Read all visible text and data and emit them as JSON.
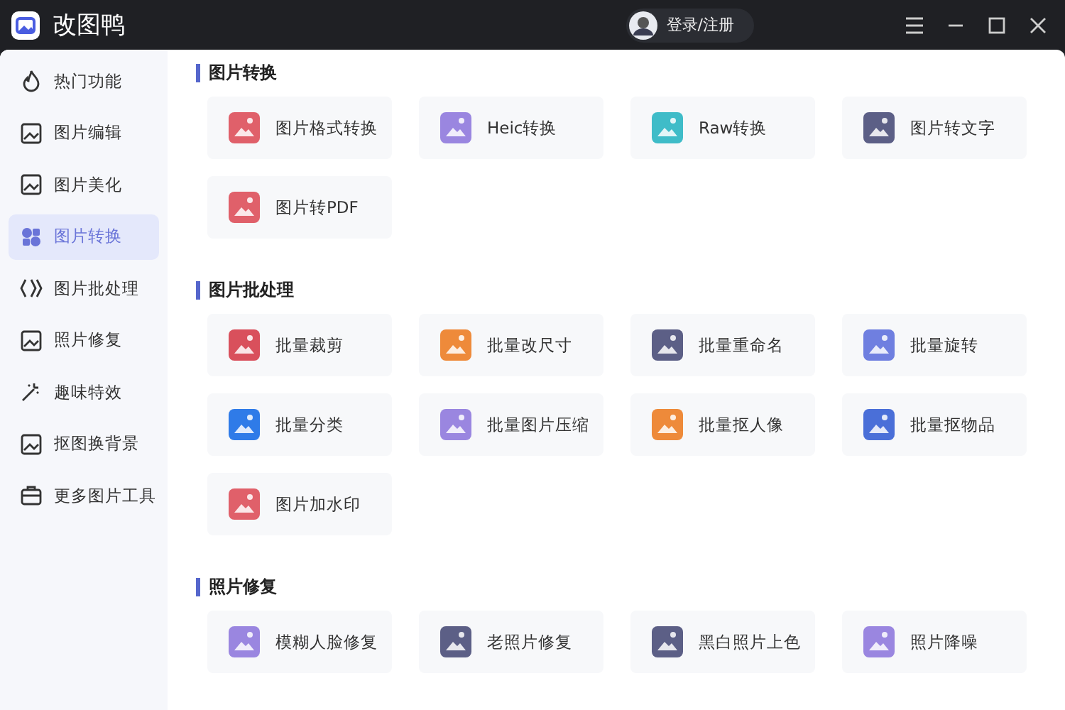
{
  "window": {
    "title": "改图鸭",
    "login": "登录/注册"
  },
  "sidebar": {
    "items": [
      {
        "label": "热门功能",
        "selected": false
      },
      {
        "label": "图片编辑",
        "selected": false
      },
      {
        "label": "图片美化",
        "selected": false
      },
      {
        "label": "图片转换",
        "selected": true
      },
      {
        "label": "图片批处理",
        "selected": false
      },
      {
        "label": "照片修复",
        "selected": false
      },
      {
        "label": "趣味特效",
        "selected": false
      },
      {
        "label": "抠图换背景",
        "selected": false
      },
      {
        "label": "更多图片工具",
        "selected": false
      }
    ]
  },
  "sections": [
    {
      "title": "图片转换",
      "tools": [
        {
          "label": "图片格式转换",
          "color": "#e0606a"
        },
        {
          "label": "Heic转换",
          "color": "#9a86e0"
        },
        {
          "label": "Raw转换",
          "color": "#3fbcc8"
        },
        {
          "label": "图片转文字",
          "color": "#5c5f86"
        },
        {
          "label": "图片转PDF",
          "color": "#e0606a"
        }
      ]
    },
    {
      "title": "图片批处理",
      "tools": [
        {
          "label": "批量裁剪",
          "color": "#d9505c"
        },
        {
          "label": "批量改尺寸",
          "color": "#ee8a3a"
        },
        {
          "label": "批量重命名",
          "color": "#5c5f86"
        },
        {
          "label": "批量旋转",
          "color": "#6f7fe0"
        },
        {
          "label": "批量分类",
          "color": "#2f7be8"
        },
        {
          "label": "批量图片压缩",
          "color": "#9a86e0"
        },
        {
          "label": "批量抠人像",
          "color": "#ee8a3a"
        },
        {
          "label": "批量抠物品",
          "color": "#4a6fd8"
        },
        {
          "label": "图片加水印",
          "color": "#e0606a"
        }
      ]
    },
    {
      "title": "照片修复",
      "tools": [
        {
          "label": "模糊人脸修复",
          "color": "#9a86e0"
        },
        {
          "label": "老照片修复",
          "color": "#5c5f86"
        },
        {
          "label": "黑白照片上色",
          "color": "#5c5f86"
        },
        {
          "label": "照片降噪",
          "color": "#9a86e0"
        }
      ]
    }
  ]
}
